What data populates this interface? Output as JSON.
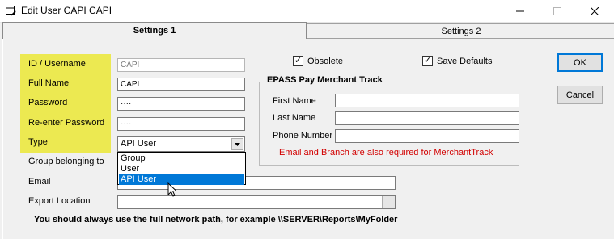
{
  "window": {
    "title": "Edit User CAPI CAPI",
    "icon": "edit-form-icon"
  },
  "tabs": [
    {
      "label": "Settings 1",
      "active": true
    },
    {
      "label": "Settings 2",
      "active": false
    }
  ],
  "form": {
    "id_label": "ID / Username",
    "id_value": "CAPI",
    "fullname_label": "Full Name",
    "fullname_value": "CAPI",
    "password_label": "Password",
    "password_value": "····",
    "reenter_label": "Re-enter Password",
    "reenter_value": "····",
    "type_label": "Type",
    "type_value": "API User",
    "type_options": [
      "Group",
      "User",
      "API User"
    ],
    "group_label": "Group belonging to",
    "email_label": "Email",
    "email_value": "",
    "export_label": "Export Location",
    "export_value": ""
  },
  "checks": {
    "obsolete_label": "Obsolete",
    "obsolete_checked": true,
    "defaults_label": "Save Defaults",
    "defaults_checked": true
  },
  "epass": {
    "title": "EPASS Pay Merchant Track",
    "first_name_label": "First Name",
    "last_name_label": "Last Name",
    "phone_label": "Phone Number",
    "warning": "Email and Branch are also required for MerchantTrack"
  },
  "buttons": {
    "ok": "OK",
    "cancel": "Cancel"
  },
  "note": "You should always use the full network path, for example \\\\SERVER\\Reports\\MyFolder",
  "colors": {
    "highlight": "#ece951",
    "selection": "#0078d7",
    "warning": "#d20000"
  }
}
